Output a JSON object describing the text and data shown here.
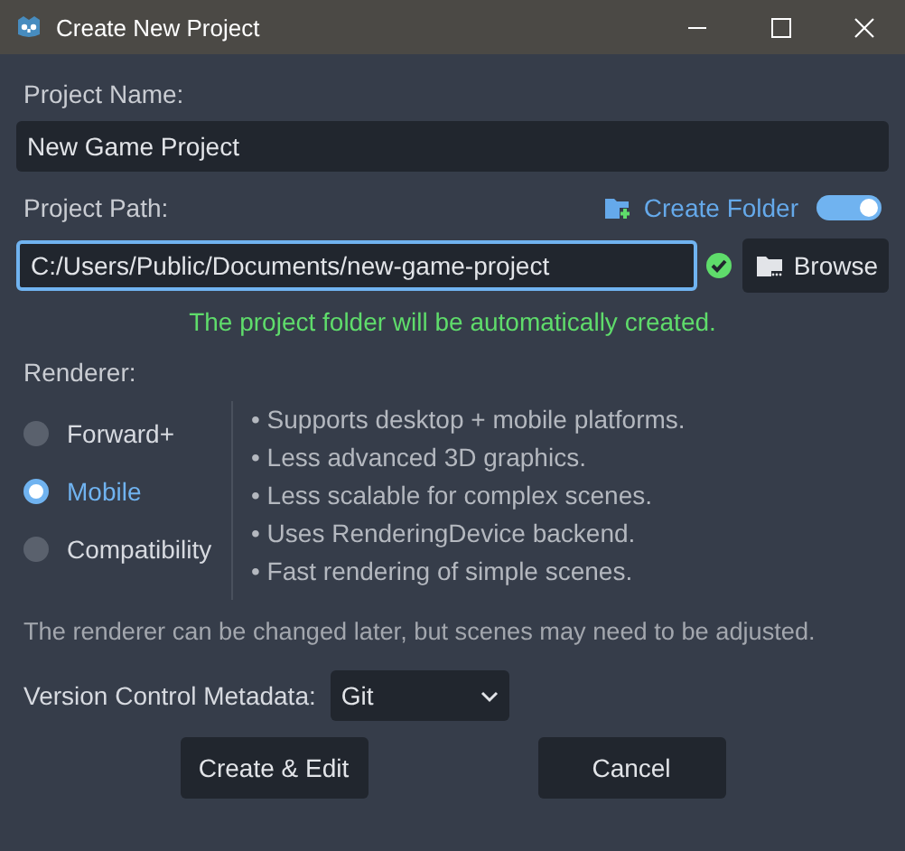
{
  "window": {
    "title": "Create New Project"
  },
  "project_name": {
    "label": "Project Name:",
    "value": "New Game Project"
  },
  "project_path": {
    "label": "Project Path:",
    "value": "C:/Users/Public/Documents/new-game-project",
    "create_folder": {
      "label": "Create Folder",
      "on": true
    },
    "browse_button": "Browse",
    "status_message": "The project folder will be automatically created."
  },
  "renderer": {
    "label": "Renderer:",
    "options": [
      {
        "label": "Forward+",
        "selected": false
      },
      {
        "label": "Mobile",
        "selected": true
      },
      {
        "label": "Compatibility",
        "selected": false
      }
    ],
    "features": [
      "• Supports desktop + mobile platforms.",
      "• Less advanced 3D graphics.",
      "• Less scalable for complex scenes.",
      "• Uses RenderingDevice backend.",
      "• Fast rendering of simple scenes."
    ]
  },
  "note": "The renderer can be changed later, but scenes may need to be adjusted.",
  "version_control": {
    "label": "Version Control Metadata:",
    "value": "Git"
  },
  "buttons": [
    "Create & Edit",
    "Cancel"
  ]
}
